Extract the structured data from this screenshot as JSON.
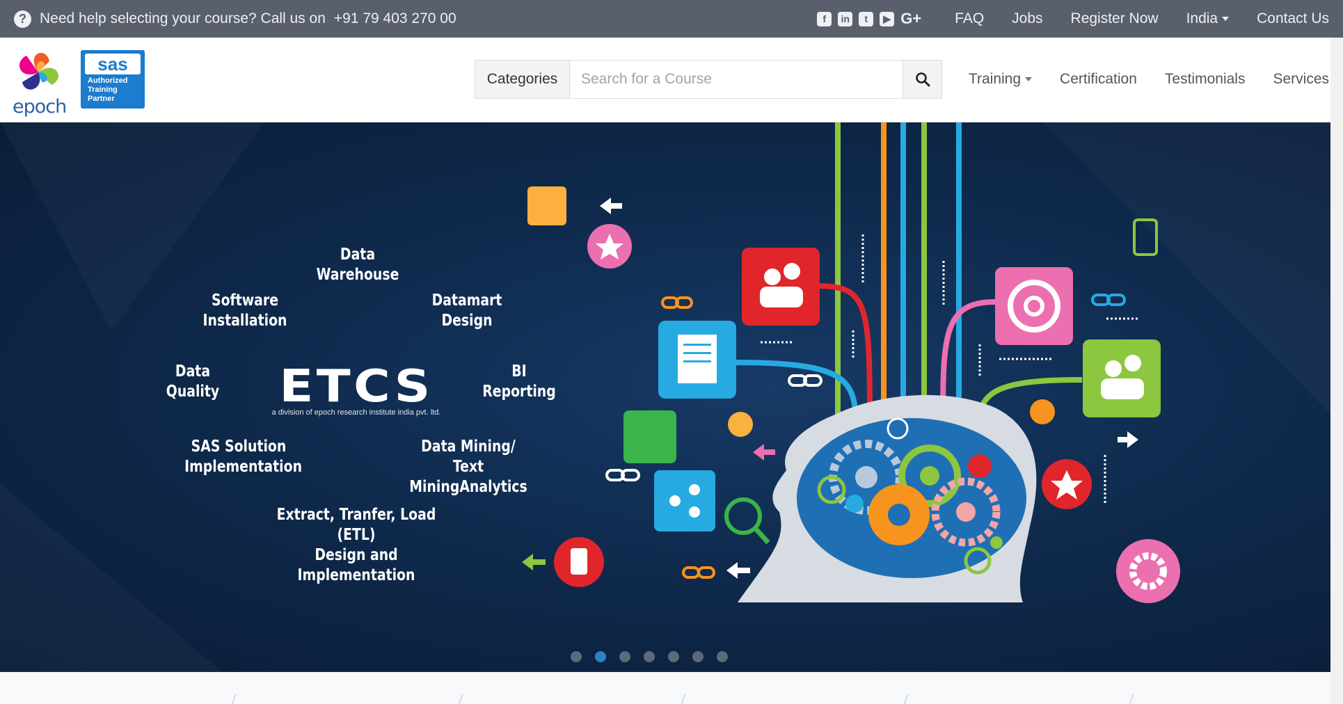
{
  "topbar": {
    "help_text": "Need help selecting your course? Call us on",
    "phone": "+91 79 403 270 00",
    "social": [
      "facebook-icon",
      "linkedin-icon",
      "twitter-icon",
      "youtube-icon",
      "google-plus-icon"
    ],
    "links": {
      "faq": "FAQ",
      "jobs": "Jobs",
      "register": "Register Now",
      "country": "India",
      "contact": "Contact Us"
    }
  },
  "header": {
    "logo_text": "epoch",
    "sas_logo": {
      "brand": "sas",
      "line1": "Authorized",
      "line2": "Training",
      "line3": "Partner"
    },
    "search": {
      "categories_label": "Categories",
      "placeholder": "Search for a Course"
    },
    "nav": {
      "training": "Training",
      "certification": "Certification",
      "testimonials": "Testimonials",
      "services": "Services"
    }
  },
  "banner": {
    "etcs_title": "ETCS",
    "etcs_sub": "a division of epoch research institute india pvt. ltd.",
    "labels": {
      "data_warehouse": "Data\nWarehouse",
      "software_installation": "Software\nInstallation",
      "datamart_design": "Datamart\nDesign",
      "data_quality": "Data\nQuality",
      "bi_reporting": "BI\nReporting",
      "sas_solution": "SAS Solution\nImplementation",
      "data_mining": "Data Mining/\nText MiningAnalytics",
      "etl": "Extract, Tranfer, Load (ETL)\nDesign and Implementation"
    },
    "slides_count": 7,
    "active_slide": 2
  },
  "colors": {
    "topbar": "#59606b",
    "accent": "#2a83c4",
    "banner_bg": "#0f2a4d"
  }
}
